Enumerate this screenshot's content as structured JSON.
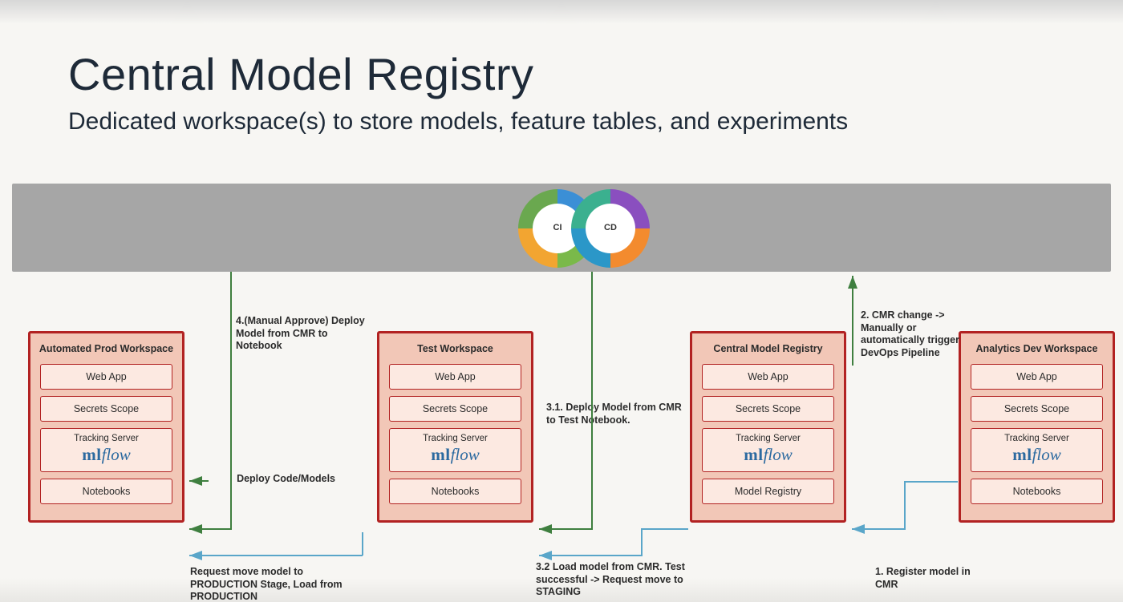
{
  "title": "Central Model Registry",
  "subtitle": "Dedicated workspace(s) to store models, feature tables, and experiments",
  "cicd": {
    "ci_label": "CI",
    "cd_label": "CD"
  },
  "workspaces": {
    "prod": {
      "title": "Automated Prod Workspace",
      "items": [
        "Web App",
        "Secrets Scope"
      ],
      "tracking_label": "Tracking Server",
      "mlflow_ml": "ml",
      "mlflow_flow": "flow",
      "notebooks": "Notebooks"
    },
    "test": {
      "title": "Test Workspace",
      "items": [
        "Web App",
        "Secrets Scope"
      ],
      "tracking_label": "Tracking Server",
      "mlflow_ml": "ml",
      "mlflow_flow": "flow",
      "notebooks": "Notebooks"
    },
    "cmr": {
      "title": "Central Model Registry",
      "items": [
        "Web App",
        "Secrets Scope"
      ],
      "tracking_label": "Tracking Server",
      "mlflow_ml": "ml",
      "mlflow_flow": "flow",
      "notebooks": "Model Registry"
    },
    "dev": {
      "title": "Analytics Dev Workspace",
      "items": [
        "Web App",
        "Secrets Scope"
      ],
      "tracking_label": "Tracking Server",
      "mlflow_ml": "ml",
      "mlflow_flow": "flow",
      "notebooks": "Notebooks"
    }
  },
  "labels": {
    "step4": "4.(Manual Approve) Deploy Model from CMR to Notebook",
    "deploy_code_models": "Deploy Code/Models",
    "request_prod": "Request move model to PRODUCTION Stage, Load from PRODUCTION",
    "step31": "3.1. Deploy Model from CMR to Test Notebook.",
    "step32": "3.2 Load model from CMR. Test successful -> Request move to STAGING",
    "step2": "2. CMR change -> Manually or automatically trigger DevOps Pipeline",
    "step1": "1. Register model in CMR"
  },
  "colors": {
    "card_border": "#b22222",
    "card_fill": "#f2c7b7",
    "item_fill": "#fce9e1",
    "bar": "#a6a6a6",
    "arrow_green": "#3f7f3f",
    "arrow_blue": "#5aa6c9",
    "mlflow_blue": "#2c6aa0"
  }
}
